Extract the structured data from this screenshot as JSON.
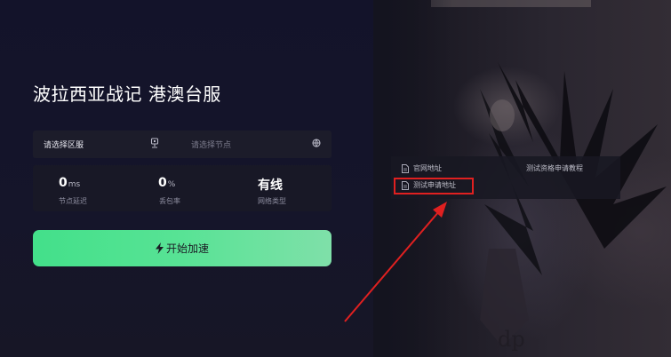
{
  "header": {
    "game_title": "波拉西亚战记 港澳台服"
  },
  "selectors": {
    "region_placeholder": "请选择区服",
    "region_icon": "location-pin-icon",
    "node_placeholder": "请选择节点",
    "node_icon": "node-globe-icon"
  },
  "stats": [
    {
      "value": "0",
      "unit": "ms",
      "label": "节点延迟"
    },
    {
      "value": "0",
      "unit": "%",
      "label": "丢包率"
    },
    {
      "value": "有线",
      "unit": "",
      "label": "网络类型"
    }
  ],
  "accelerate": {
    "label": "开始加速",
    "icon": "lightning-bolt-icon",
    "gradient_start": "#43e08a",
    "gradient_end": "#7fe0a9"
  },
  "links_menu": {
    "items": [
      {
        "label": "官网地址",
        "icon": "document-icon"
      },
      {
        "label": "测试资格申请教程",
        "icon": ""
      },
      {
        "label": "测试申请地址",
        "icon": "document-icon",
        "highlighted": true
      }
    ]
  },
  "annotation": {
    "highlight_color": "#e02020"
  }
}
